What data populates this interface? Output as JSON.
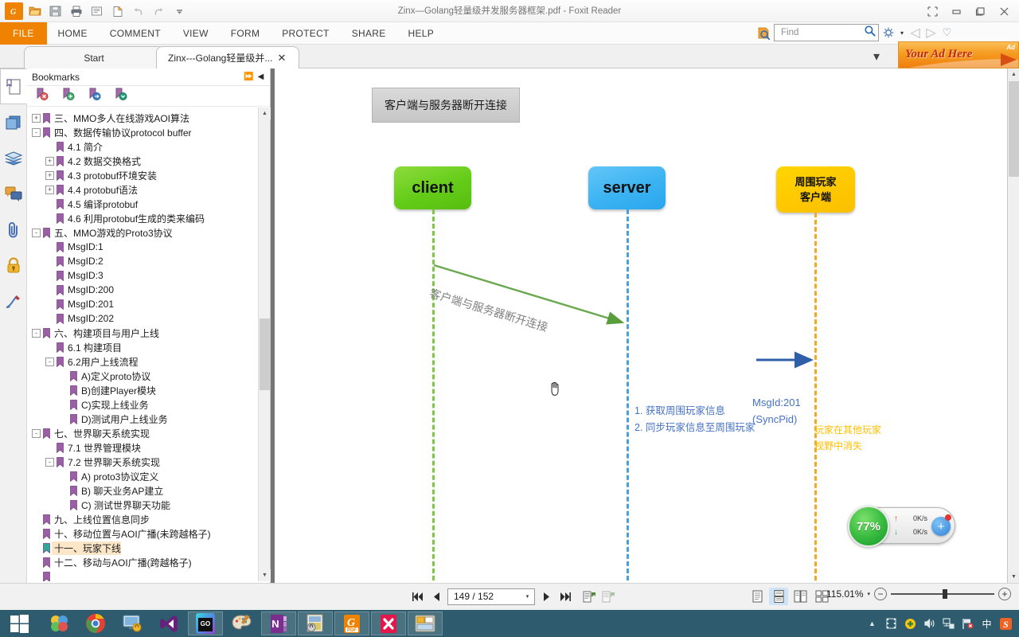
{
  "window": {
    "title": "Zinx—Golang轻量级并发服务器框架.pdf - Foxit Reader",
    "minimize": "—",
    "maximize": "▢",
    "restore": "❐",
    "close": "✕"
  },
  "quick_access": [
    {
      "name": "foxit-logo-icon",
      "label": "Foxit"
    },
    {
      "name": "open-icon",
      "label": "Open"
    },
    {
      "name": "save-icon",
      "label": "Save"
    },
    {
      "name": "print-icon",
      "label": "Print"
    },
    {
      "name": "email-icon",
      "label": "Email"
    },
    {
      "name": "create-pdf-icon",
      "label": "Create PDF"
    },
    {
      "name": "undo-icon",
      "label": "Undo"
    },
    {
      "name": "redo-icon",
      "label": "Redo"
    },
    {
      "name": "customize-icon",
      "label": "Customize"
    }
  ],
  "ribbon": {
    "tabs": [
      {
        "id": "file",
        "label": "FILE"
      },
      {
        "id": "home",
        "label": "HOME"
      },
      {
        "id": "comment",
        "label": "COMMENT"
      },
      {
        "id": "view",
        "label": "VIEW"
      },
      {
        "id": "form",
        "label": "FORM"
      },
      {
        "id": "protect",
        "label": "PROTECT"
      },
      {
        "id": "share",
        "label": "SHARE"
      },
      {
        "id": "help",
        "label": "HELP"
      }
    ],
    "find": {
      "placeholder": "Find",
      "value": "",
      "scope_icon": "search-scope-icon",
      "search_icon": "magnifier-icon",
      "settings_icon": "gear-icon",
      "settings_caret": "▾",
      "prev_icon": "◁",
      "next_icon": "▷",
      "heart_icon": "♡"
    }
  },
  "doc_tabs": {
    "items": [
      {
        "label": "Start",
        "active": false,
        "closable": false
      },
      {
        "label": "Zinx---Golang轻量级并...",
        "active": true,
        "closable": true,
        "close": "✕"
      }
    ],
    "dropdown": "▾"
  },
  "ad": {
    "text": "Your Ad Here",
    "corner": "Ad"
  },
  "left_toolbar": [
    {
      "name": "page-thumbnails-icon",
      "label": "Page Thumbnails",
      "active": true
    },
    {
      "name": "layers-panel-icon",
      "label": "Layers"
    },
    {
      "name": "stack-panel-icon",
      "label": "Pages"
    },
    {
      "name": "comments-panel-icon",
      "label": "Comments"
    },
    {
      "name": "attachments-panel-icon",
      "label": "Attachments"
    },
    {
      "name": "security-panel-icon",
      "label": "Security"
    },
    {
      "name": "signature-panel-icon",
      "label": "Signatures"
    }
  ],
  "bookmarks": {
    "title": "Bookmarks",
    "expand_icon": "⏩",
    "collapse_icon": "◀",
    "toolbar": [
      {
        "name": "delete-bookmark-icon",
        "label": "Delete"
      },
      {
        "name": "add-bookmark-icon",
        "label": "Add"
      },
      {
        "name": "move-bookmark-icon",
        "label": "Move"
      },
      {
        "name": "collapse-bookmark-icon",
        "label": "Collapse"
      }
    ],
    "items": [
      {
        "label": "三、MMO多人在线游戏AOI算法",
        "indent": 0,
        "expander": "+",
        "selected": false
      },
      {
        "label": "四、数据传输协议protocol buffer",
        "indent": 0,
        "expander": "-",
        "selected": false
      },
      {
        "label": "4.1 简介",
        "indent": 1,
        "expander": "",
        "selected": false
      },
      {
        "label": "4.2 数据交换格式",
        "indent": 1,
        "expander": "+",
        "selected": false
      },
      {
        "label": "4.3 protobuf环境安装",
        "indent": 1,
        "expander": "+",
        "selected": false
      },
      {
        "label": "4.4 protobuf语法",
        "indent": 1,
        "expander": "+",
        "selected": false
      },
      {
        "label": "4.5 编译protobuf",
        "indent": 1,
        "expander": "",
        "selected": false
      },
      {
        "label": "4.6 利用protobuf生成的类来编码",
        "indent": 1,
        "expander": "",
        "selected": false
      },
      {
        "label": "五、MMO游戏的Proto3协议",
        "indent": 0,
        "expander": "-",
        "selected": false
      },
      {
        "label": "MsgID:1",
        "indent": 1,
        "expander": "",
        "selected": false
      },
      {
        "label": "MsgID:2",
        "indent": 1,
        "expander": "",
        "selected": false
      },
      {
        "label": "MsgID:3",
        "indent": 1,
        "expander": "",
        "selected": false
      },
      {
        "label": "MsgID:200",
        "indent": 1,
        "expander": "",
        "selected": false
      },
      {
        "label": "MsgID:201",
        "indent": 1,
        "expander": "",
        "selected": false
      },
      {
        "label": "MsgID:202",
        "indent": 1,
        "expander": "",
        "selected": false
      },
      {
        "label": "六、构建项目与用户上线",
        "indent": 0,
        "expander": "-",
        "selected": false
      },
      {
        "label": "6.1 构建项目",
        "indent": 1,
        "expander": "",
        "selected": false
      },
      {
        "label": "6.2用户上线流程",
        "indent": 1,
        "expander": "-",
        "selected": false
      },
      {
        "label": "A)定义proto协议",
        "indent": 2,
        "expander": "",
        "selected": false
      },
      {
        "label": "B)创建Player模块",
        "indent": 2,
        "expander": "",
        "selected": false
      },
      {
        "label": "C)实现上线业务",
        "indent": 2,
        "expander": "",
        "selected": false
      },
      {
        "label": "D)测试用户上线业务",
        "indent": 2,
        "expander": "",
        "selected": false
      },
      {
        "label": "七、世界聊天系统实现",
        "indent": 0,
        "expander": "-",
        "selected": false
      },
      {
        "label": "7.1 世界管理模块",
        "indent": 1,
        "expander": "",
        "selected": false
      },
      {
        "label": "7.2 世界聊天系统实现",
        "indent": 1,
        "expander": "-",
        "selected": false
      },
      {
        "label": "A) proto3协议定义",
        "indent": 2,
        "expander": "",
        "selected": false
      },
      {
        "label": "B) 聊天业务AP建立",
        "indent": 2,
        "expander": "",
        "selected": false
      },
      {
        "label": "C) 测试世界聊天功能",
        "indent": 2,
        "expander": "",
        "selected": false
      },
      {
        "label": "九、上线位置信息同步",
        "indent": 0,
        "expander": "",
        "selected": false
      },
      {
        "label": "十、移动位置与AOI广播(未跨越格子)",
        "indent": 0,
        "expander": "",
        "selected": false
      },
      {
        "label": "十一、玩家下线",
        "indent": 0,
        "expander": "",
        "selected": true
      },
      {
        "label": "十二、移动与AOI广播(跨越格子)",
        "indent": 0,
        "expander": "",
        "selected": false
      },
      {
        "label": "",
        "indent": 0,
        "expander": "",
        "selected": false
      }
    ]
  },
  "diagram": {
    "title_box": "客户端与服务器断开连接",
    "nodes": [
      {
        "id": "client",
        "label": "client",
        "color": "#64cc18"
      },
      {
        "id": "server",
        "label": "server",
        "color": "#3bb3f2"
      },
      {
        "id": "around",
        "label_line1": "周围玩家",
        "label_line2": "客户端",
        "color": "#ffc800"
      }
    ],
    "arrow_label": "客户端与服务器断开连接",
    "steps": [
      "1. 获取周围玩家信息",
      "2. 同步玩家信息至周围玩家"
    ],
    "msg_id": "MsgId:201",
    "msg_name": "(SyncPid)",
    "result_line1": "玩家在其他玩家",
    "result_line2": "视野中消失",
    "colors": {
      "client": "#7ac943",
      "server": "#4a9fe0",
      "around": "#f5a623",
      "blue_text": "#4472c4",
      "orange_text": "#ffc000",
      "gray_label": "#7f7f7f"
    }
  },
  "status_bar": {
    "first_page_icon": "◀◀",
    "prev_page_icon": "◀",
    "page_value": "149 / 152",
    "page_dropdown": "▾",
    "next_page_icon": "▶",
    "last_page_icon": "▶▶",
    "fit_page_icon": "fit-page-icon",
    "fit_width_icon": "fit-width-icon",
    "view_modes": [
      {
        "name": "single-page-view-icon",
        "active": false
      },
      {
        "name": "continuous-view-icon",
        "active": true
      },
      {
        "name": "facing-view-icon",
        "active": false
      },
      {
        "name": "continuous-facing-view-icon",
        "active": false
      }
    ],
    "zoom_value": "115.01%",
    "zoom_dropdown": "▾",
    "zoom_out": "−",
    "zoom_in": "+"
  },
  "net_widget": {
    "percent": "77%",
    "upload": "0K/s",
    "download": "0K/s",
    "up_arrow": "↑",
    "down_arrow": "↓",
    "add_button": "+"
  },
  "taskbar": {
    "start": "start-button",
    "items": [
      {
        "name": "taskbar-windows-live-icon",
        "running": false
      },
      {
        "name": "taskbar-chrome-icon",
        "running": false
      },
      {
        "name": "taskbar-remote-desktop-icon",
        "running": false
      },
      {
        "name": "taskbar-visual-studio-icon",
        "running": false
      },
      {
        "name": "taskbar-goland-icon",
        "running": true
      },
      {
        "name": "taskbar-paint-icon",
        "running": false
      },
      {
        "name": "taskbar-onenote-icon",
        "running": true
      },
      {
        "name": "taskbar-secure-doc-icon",
        "running": true
      },
      {
        "name": "taskbar-foxit-reader-icon",
        "running": true
      },
      {
        "name": "taskbar-xmind-icon",
        "running": true
      },
      {
        "name": "taskbar-file-explorer-icon",
        "running": true
      }
    ],
    "tray": [
      {
        "name": "tray-show-hidden-icon",
        "glyph": "▲"
      },
      {
        "name": "tray-media-icon",
        "glyph": "▤"
      },
      {
        "name": "tray-update-icon",
        "glyph": "✚"
      },
      {
        "name": "tray-volume-icon",
        "glyph": "🔊"
      },
      {
        "name": "tray-network-icon",
        "glyph": "🖧"
      },
      {
        "name": "tray-flag-icon",
        "glyph": "⚑"
      },
      {
        "name": "tray-ime-icon",
        "glyph": "中"
      },
      {
        "name": "tray-sogou-icon",
        "glyph": "S"
      }
    ]
  }
}
